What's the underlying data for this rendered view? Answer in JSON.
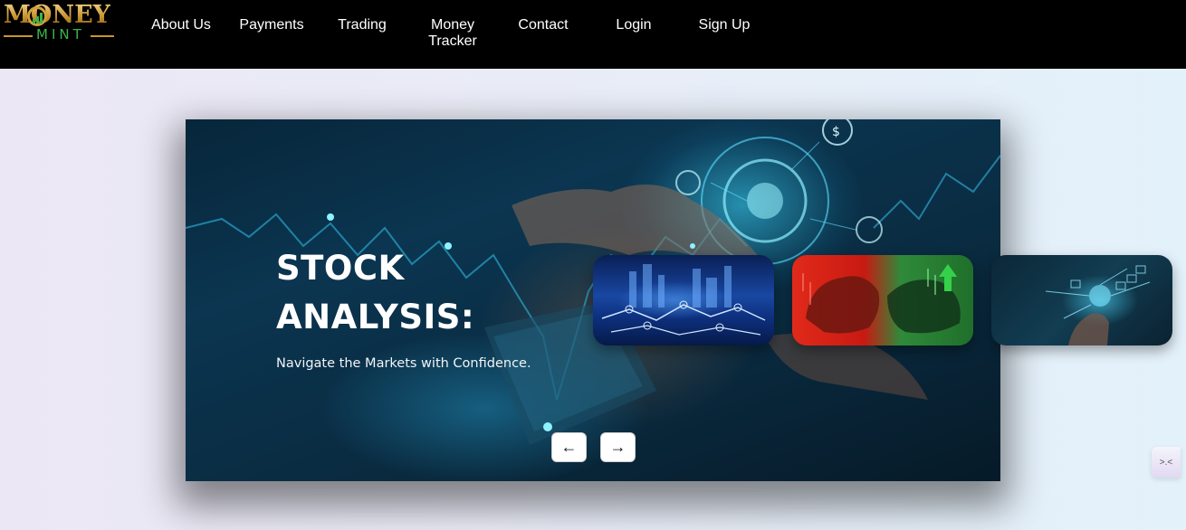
{
  "brand": {
    "logo_top": "MONEY",
    "logo_bottom": "MINT"
  },
  "nav": {
    "items": [
      {
        "label": "About Us"
      },
      {
        "label": "Payments"
      },
      {
        "label": "Trading"
      },
      {
        "label": "Money Tracker"
      },
      {
        "label": "Contact"
      },
      {
        "label": "Login"
      },
      {
        "label": "Sign Up"
      }
    ]
  },
  "hero": {
    "title": "STOCK ANALYSIS:",
    "subtitle": "Navigate the Markets with Confidence.",
    "prev_icon": "arrow-left-icon",
    "next_icon": "arrow-right-icon",
    "prev_glyph": "←",
    "next_glyph": "→"
  },
  "thumbnails": [
    {
      "name": "city-network-thumbnail"
    },
    {
      "name": "bear-bull-thumbnail"
    },
    {
      "name": "digital-finance-thumbnail"
    }
  ],
  "colors": {
    "nav_bg": "#000000",
    "logo_gold": "#c9952e",
    "logo_green": "#3bb54a",
    "hero_text": "#ffffff"
  }
}
